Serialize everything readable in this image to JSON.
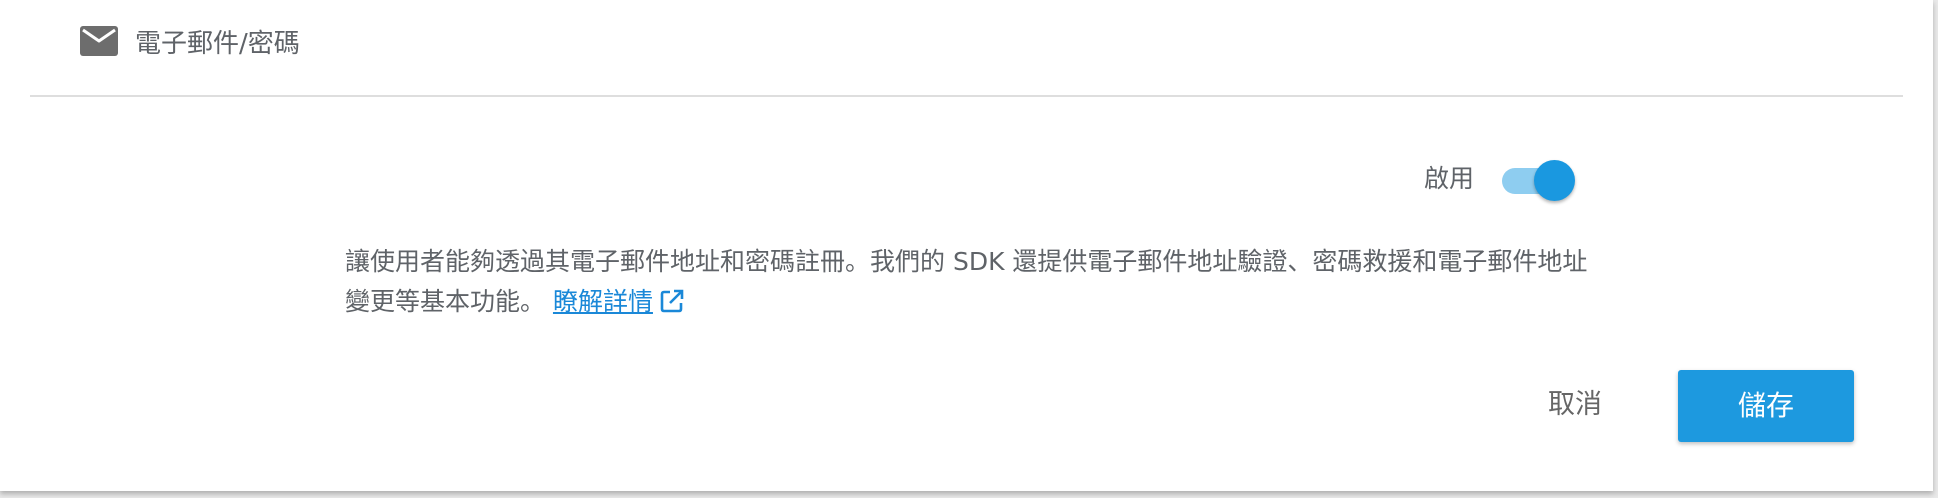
{
  "header": {
    "icon": "mail-icon",
    "title": "電子郵件/密碼"
  },
  "enable": {
    "label": "啟用",
    "state": true,
    "accent_color": "#1a98e0"
  },
  "description": {
    "text": "讓使用者能夠透過其電子郵件地址和密碼註冊。我們的 SDK 還提供電子郵件地址驗證、密碼救援和電子郵件地址變更等基本功能。 ",
    "link_text": "瞭解詳情",
    "link_icon": "open-in-new-icon"
  },
  "actions": {
    "cancel_label": "取消",
    "save_label": "儲存",
    "save_color": "#1d99df"
  }
}
